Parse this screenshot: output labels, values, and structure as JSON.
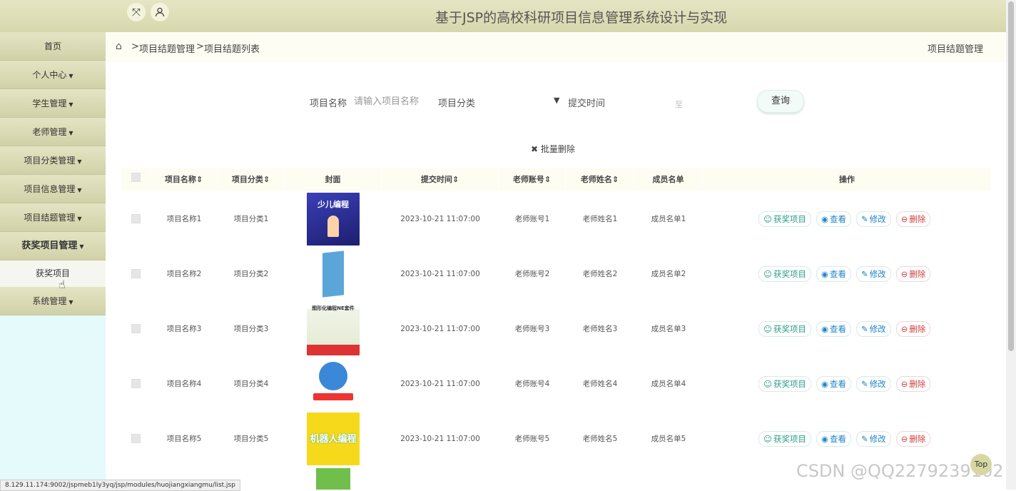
{
  "header": {
    "title": "基于JSP的高校科研项目信息管理系统设计与实现"
  },
  "sidebar": {
    "items": [
      {
        "label": "首页"
      },
      {
        "label": "个人中心"
      },
      {
        "label": "学生管理"
      },
      {
        "label": "老师管理"
      },
      {
        "label": "项目分类管理"
      },
      {
        "label": "项目信息管理"
      },
      {
        "label": "项目结题管理"
      },
      {
        "label": "获奖项目管理"
      },
      {
        "label": "系统管理"
      }
    ],
    "sub_item": "获奖项目"
  },
  "breadcrumb": {
    "level1": "项目结题管理",
    "level2": "项目结题列表",
    "right": "项目结题管理"
  },
  "search": {
    "name_label": "项目名称",
    "name_placeholder": "请输入项目名称",
    "category_label": "项目分类",
    "time_label": "提交时间",
    "time_to": "至",
    "query_button": "查询"
  },
  "batch_delete": "批量删除",
  "table": {
    "headers": [
      "项目名称",
      "项目分类",
      "封面",
      "提交时间",
      "老师账号",
      "老师姓名",
      "成员名单",
      "操作"
    ],
    "rows": [
      {
        "name": "项目名称1",
        "category": "项目分类1",
        "time": "2023-10-21 11:07:00",
        "teacher_account": "老师账号1",
        "teacher_name": "老师姓名1",
        "members": "成员名单1"
      },
      {
        "name": "项目名称2",
        "category": "项目分类2",
        "time": "2023-10-21 11:07:00",
        "teacher_account": "老师账号2",
        "teacher_name": "老师姓名2",
        "members": "成员名单2"
      },
      {
        "name": "项目名称3",
        "category": "项目分类3",
        "time": "2023-10-21 11:07:00",
        "teacher_account": "老师账号3",
        "teacher_name": "老师姓名3",
        "members": "成员名单3"
      },
      {
        "name": "项目名称4",
        "category": "项目分类4",
        "time": "2023-10-21 11:07:00",
        "teacher_account": "老师账号4",
        "teacher_name": "老师姓名4",
        "members": "成员名单4"
      },
      {
        "name": "项目名称5",
        "category": "项目分类5",
        "time": "2023-10-21 11:07:00",
        "teacher_account": "老师账号5",
        "teacher_name": "老师姓名5",
        "members": "成员名单5"
      }
    ],
    "actions": {
      "award": "获奖项目",
      "view": "查看",
      "edit": "修改",
      "delete": "删除"
    },
    "cover_titles": [
      "少儿编程",
      "",
      "图形化编程NE套件",
      "",
      "机器人编程"
    ]
  },
  "status_url": "8.129.11.174:9002/jspmeb1ly3yq/jsp/modules/huojiangxiangmu/list.jsp",
  "watermark": "CSDN @QQ2279239102",
  "top_button": "Top",
  "colors": {
    "header_bg": "#d7d7ad",
    "sidebar_bg": "#e5fafa",
    "accent": "#2d9c88",
    "danger": "#d23b3b"
  }
}
